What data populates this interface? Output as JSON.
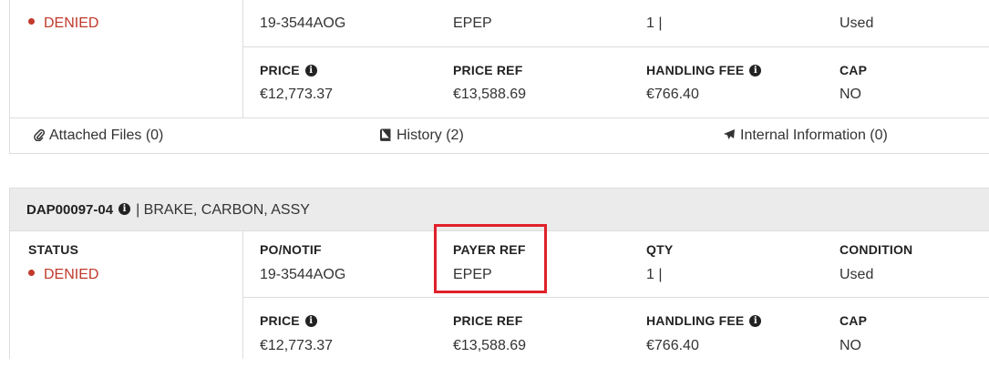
{
  "card1": {
    "status_value": "DENIED",
    "fields_row1": {
      "po_notif": "19-3544AOG",
      "payer_ref": "EPEP",
      "qty": "1 |",
      "condition": "Used"
    },
    "fields_row2": {
      "price_label": "PRICE",
      "price_value": "€12,773.37",
      "price_ref_label": "PRICE REF",
      "price_ref_value": "€13,588.69",
      "handling_fee_label": "HANDLING FEE",
      "handling_fee_value": "€766.40",
      "cap_label": "CAP",
      "cap_value": "NO"
    }
  },
  "tabs": {
    "attached_files": "Attached Files (0)",
    "history": "History (2)",
    "internal_information": "Internal Information (0)"
  },
  "card2": {
    "header_id": "DAP00097-04",
    "header_desc": "| BRAKE, CARBON, ASSY",
    "status_label": "STATUS",
    "status_value": "DENIED",
    "fields_row1": {
      "po_notif_label": "PO/NOTIF",
      "po_notif": "19-3544AOG",
      "payer_ref_label": "PAYER REF",
      "payer_ref": "EPEP",
      "qty_label": "QTY",
      "qty": "1 |",
      "condition_label": "CONDITION",
      "condition": "Used"
    },
    "fields_row2": {
      "price_label": "PRICE",
      "price_value": "€12,773.37",
      "price_ref_label": "PRICE REF",
      "price_ref_value": "€13,588.69",
      "handling_fee_label": "HANDLING FEE",
      "handling_fee_value": "€766.40",
      "cap_label": "CAP",
      "cap_value": "NO"
    }
  },
  "colors": {
    "denied": "#c0392b",
    "highlight_box": "#e0202a",
    "header_bg": "#ebebeb"
  },
  "icons": [
    "info-icon",
    "paperclip-icon",
    "book-icon",
    "plane-icon"
  ]
}
